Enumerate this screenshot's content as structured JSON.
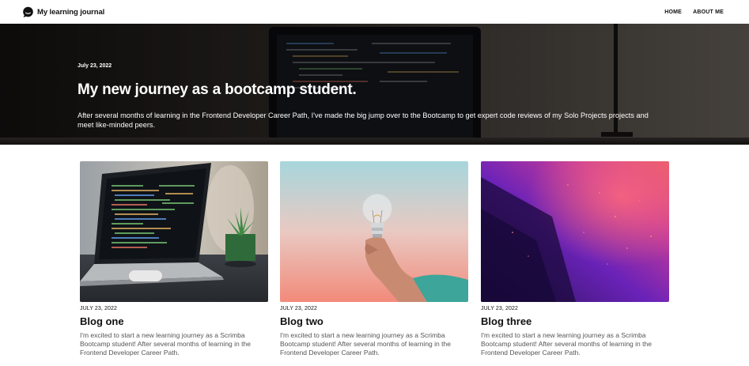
{
  "header": {
    "brand_name": "My learning journal",
    "brand_icon": "chat-bubble-icon",
    "nav": [
      {
        "label": "HOME"
      },
      {
        "label": "ABOUT ME"
      }
    ]
  },
  "hero": {
    "date": "July 23, 2022",
    "title": "My new journey as a bootcamp student.",
    "text": "After several months of learning in the Frontend Developer Career Path, I've made the big jump over to the Bootcamp to get expert code reviews of my Solo Projects projects and meet like-minded peers."
  },
  "posts": [
    {
      "date": "JULY 23, 2022",
      "title": "Blog one",
      "excerpt": "I'm excited to start a new learning journey as a Scrimba Bootcamp student! After several months of learning in the Frontend Developer Career Path."
    },
    {
      "date": "JULY 23, 2022",
      "title": "Blog two",
      "excerpt": "I'm excited to start a new learning journey as a Scrimba Bootcamp student! After several months of learning in the Frontend Developer Career Path."
    },
    {
      "date": "JULY 23, 2022",
      "title": "Blog three",
      "excerpt": "I'm excited to start a new learning journey as a Scrimba Bootcamp student! After several months of learning in the Frontend Developer Career Path."
    }
  ],
  "colors": {
    "header_bg": "#ffffff",
    "hero_overlay": "#1e1b19",
    "text_primary": "#111111",
    "text_muted": "#555555"
  }
}
